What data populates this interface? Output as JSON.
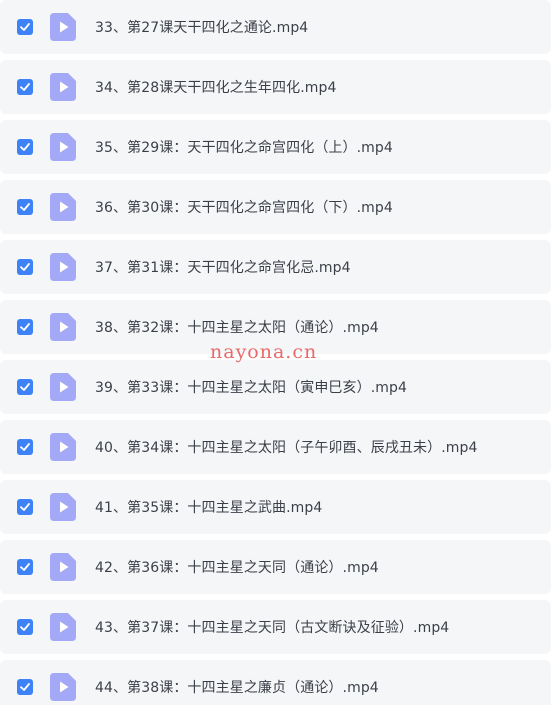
{
  "files": [
    {
      "name": "33、第27课天干四化之通论.mp4",
      "checked": true
    },
    {
      "name": "34、第28课天干四化之生年四化.mp4",
      "checked": true
    },
    {
      "name": "35、第29课：天干四化之命宫四化（上）.mp4",
      "checked": true
    },
    {
      "name": "36、第30课：天干四化之命宫四化（下）.mp4",
      "checked": true
    },
    {
      "name": "37、第31课：天干四化之命宫化忌.mp4",
      "checked": true
    },
    {
      "name": "38、第32课：十四主星之太阳（通论）.mp4",
      "checked": true
    },
    {
      "name": "39、第33课：十四主星之太阳（寅申巳亥）.mp4",
      "checked": true
    },
    {
      "name": "40、第34课：十四主星之太阳（子午卯酉、辰戌丑未）.mp4",
      "checked": true
    },
    {
      "name": "41、第35课：十四主星之武曲.mp4",
      "checked": true
    },
    {
      "name": "42、第36课：十四主星之天同（通论）.mp4",
      "checked": true
    },
    {
      "name": "43、第37课：十四主星之天同（古文断诀及征验）.mp4",
      "checked": true
    },
    {
      "name": "44、第38课：十四主星之廉贞（通论）.mp4",
      "checked": true
    }
  ],
  "watermark": "nayona.cn",
  "colors": {
    "row_bg": "#f5f6f8",
    "checkbox": "#3d82f7",
    "file_icon": "#a4a9f7",
    "text": "#3b3f48",
    "watermark": "#e85a5a"
  },
  "icons": {
    "checkbox": "checkmark-icon",
    "file": "video-file-icon"
  }
}
